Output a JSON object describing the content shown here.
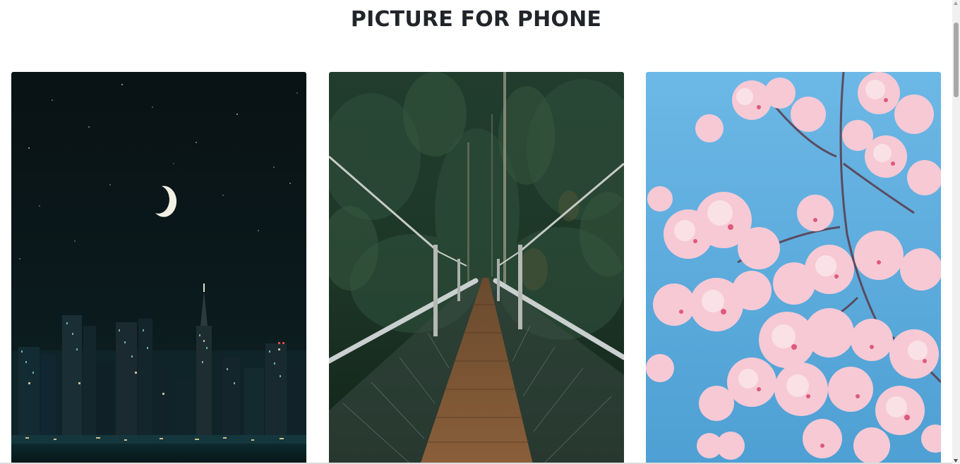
{
  "page": {
    "title": "PICTURE FOR PHONE"
  },
  "gallery": {
    "cards": [
      {
        "name": "night-city-skyline",
        "image": "night-city-skyline-with-crescent-moon"
      },
      {
        "name": "forest-suspension-bridge",
        "image": "forest-suspension-bridge"
      },
      {
        "name": "cherry-blossom",
        "image": "pink-cherry-blossom-against-blue-sky"
      }
    ]
  },
  "colors": {
    "title_text": "#212529",
    "night_sky": "#0b1518",
    "forest": "#1d3a2a",
    "blossom_sky": "#5aa9dc",
    "blossom_pink": "#f3bccb"
  }
}
